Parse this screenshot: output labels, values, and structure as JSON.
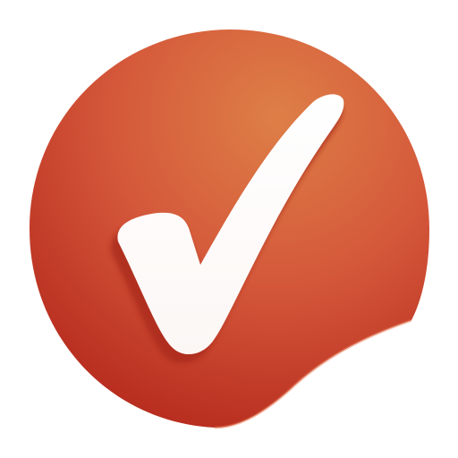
{
  "app_icon": {
    "icon": "checkmark-sticker-icon",
    "colors": {
      "background": "#ffffff",
      "sticker_light": "#DE7F47",
      "sticker_mid": "#D4573A",
      "sticker_dark": "#B5291C",
      "check_fill": "#FCF7F5",
      "check_shadow": "#A8281C"
    }
  }
}
